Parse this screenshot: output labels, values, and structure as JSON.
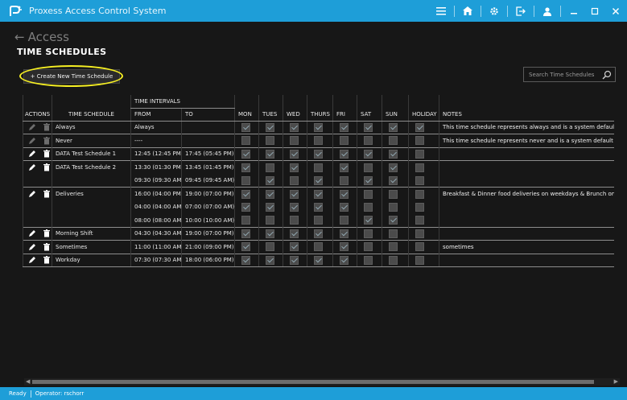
{
  "titlebar": {
    "title": "Proxess Access Control System",
    "icons": [
      "menu-icon",
      "home-icon",
      "gear-icon",
      "logout-icon",
      "user-icon",
      "minimize-icon",
      "maximize-icon",
      "close-icon"
    ]
  },
  "header": {
    "back_label": "Access",
    "page_title": "TIME SCHEDULES"
  },
  "toolbar": {
    "create_label": "+ Create New Time Schedule",
    "search_placeholder": "Search Time Schedules"
  },
  "table": {
    "group_header": "TIME INTERVALS",
    "columns": {
      "actions": "ACTIONS",
      "schedule": "TIME SCHEDULE",
      "from": "FROM",
      "to": "TO",
      "mon": "MON",
      "tues": "TUES",
      "wed": "WED",
      "thurs": "THURS",
      "fri": "FRI",
      "sat": "SAT",
      "sun": "SUN",
      "holiday": "HOLIDAY",
      "notes": "NOTES"
    },
    "schedules": [
      {
        "name": "Always",
        "editable": false,
        "notes": "This time schedule represents always and is a system default",
        "intervals": [
          {
            "from": "Always",
            "to": "",
            "days": [
              true,
              true,
              true,
              true,
              true,
              true,
              true,
              true
            ]
          }
        ]
      },
      {
        "name": "Never",
        "editable": false,
        "notes": "This time schedule represents never and is a system default",
        "intervals": [
          {
            "from": "----",
            "to": "",
            "days": [
              false,
              false,
              false,
              false,
              false,
              false,
              false,
              false
            ]
          }
        ]
      },
      {
        "name": "DATA Test Schedule 1",
        "editable": true,
        "notes": "",
        "intervals": [
          {
            "from": "12:45 (12:45 PM)",
            "to": "17:45 (05:45 PM)",
            "days": [
              true,
              true,
              true,
              true,
              true,
              true,
              true,
              false
            ]
          }
        ]
      },
      {
        "name": "DATA Test Schedule 2",
        "editable": true,
        "notes": "",
        "intervals": [
          {
            "from": "13:30 (01:30 PM)",
            "to": "13:45 (01:45 PM)",
            "days": [
              true,
              false,
              true,
              false,
              true,
              false,
              true,
              false
            ]
          },
          {
            "from": "09:30 (09:30 AM)",
            "to": "09:45 (09:45 AM)",
            "days": [
              false,
              true,
              false,
              true,
              false,
              true,
              true,
              false
            ]
          }
        ]
      },
      {
        "name": "Deliveries",
        "editable": true,
        "notes": "Breakfast & Dinner food deliveries on weekdays & Brunch on",
        "intervals": [
          {
            "from": "16:00 (04:00 PM)",
            "to": "19:00 (07:00 PM)",
            "days": [
              true,
              true,
              true,
              true,
              true,
              false,
              false,
              false
            ]
          },
          {
            "from": "04:00 (04:00 AM)",
            "to": "07:00 (07:00 AM)",
            "days": [
              true,
              true,
              true,
              true,
              true,
              false,
              false,
              false
            ]
          },
          {
            "from": "08:00 (08:00 AM)",
            "to": "10:00 (10:00 AM)",
            "days": [
              false,
              false,
              false,
              false,
              false,
              true,
              true,
              false
            ]
          }
        ]
      },
      {
        "name": "Morning Shift",
        "editable": true,
        "notes": "",
        "intervals": [
          {
            "from": "04:30 (04:30 AM)",
            "to": "19:00 (07:00 PM)",
            "days": [
              true,
              true,
              true,
              true,
              true,
              false,
              false,
              false
            ]
          }
        ]
      },
      {
        "name": "Sometimes",
        "editable": true,
        "notes": "sometimes",
        "intervals": [
          {
            "from": "11:00 (11:00 AM)",
            "to": "21:00 (09:00 PM)",
            "days": [
              true,
              false,
              true,
              false,
              true,
              false,
              false,
              false
            ]
          }
        ]
      },
      {
        "name": "Workday",
        "editable": true,
        "notes": "",
        "intervals": [
          {
            "from": "07:30 (07:30 AM)",
            "to": "18:00 (06:00 PM)",
            "days": [
              true,
              true,
              true,
              true,
              true,
              false,
              false,
              false
            ]
          }
        ]
      }
    ]
  },
  "statusbar": {
    "ready": "Ready",
    "operator": "Operator: rschorr"
  }
}
